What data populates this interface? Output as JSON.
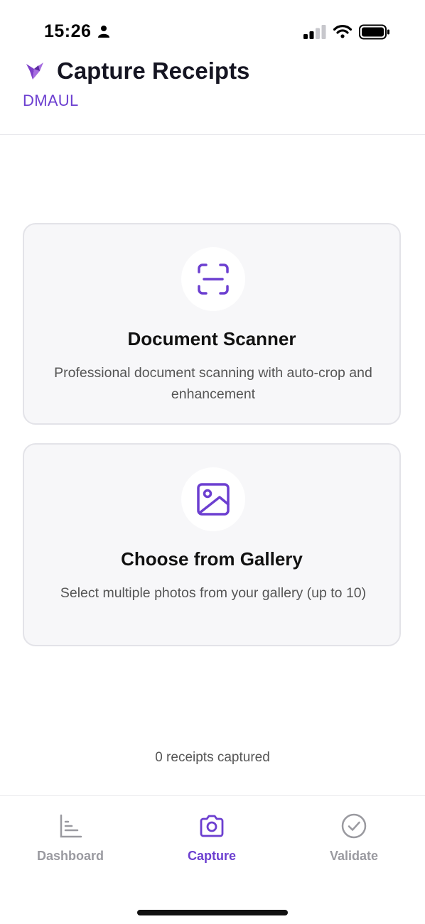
{
  "status_bar": {
    "time": "15:26"
  },
  "header": {
    "title": "Capture Receipts",
    "org": "DMAUL"
  },
  "cards": [
    {
      "title": "Document Scanner",
      "description": "Professional document scanning with auto-crop and enhancement",
      "icon": "scan-icon"
    },
    {
      "title": "Choose from Gallery",
      "description": "Select multiple photos from your gallery (up to 10)",
      "icon": "image-icon"
    }
  ],
  "captured_count": "0 receipts captured",
  "tabs": [
    {
      "label": "Dashboard",
      "icon": "chart-icon",
      "active": false
    },
    {
      "label": "Capture",
      "icon": "camera-icon",
      "active": true
    },
    {
      "label": "Validate",
      "icon": "check-circle-icon",
      "active": false
    }
  ],
  "colors": {
    "accent": "#6c3fd0",
    "inactive": "#9a9aa0",
    "card_bg": "#f7f7f9"
  }
}
